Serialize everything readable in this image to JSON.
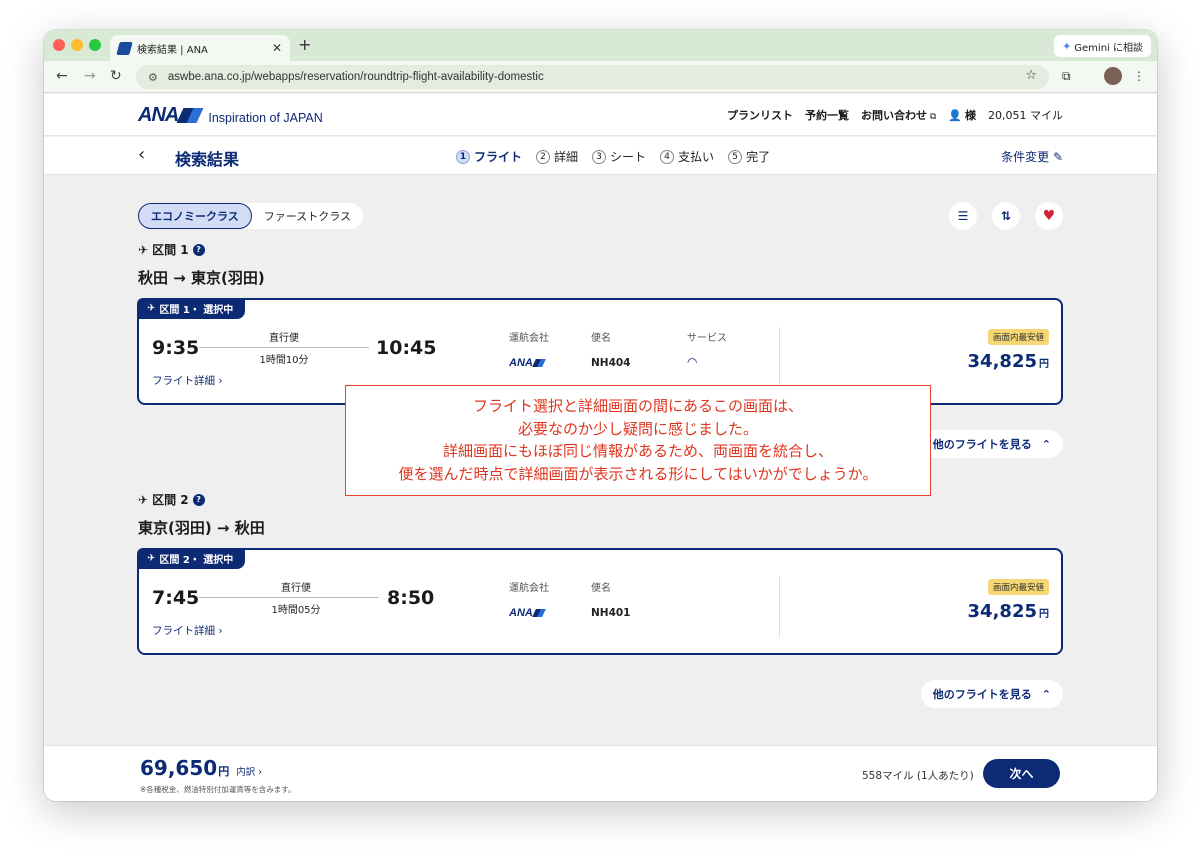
{
  "browser": {
    "tab_title": "検索結果 | ANA",
    "tab_close": "✕",
    "new_tab": "+",
    "url": "aswbe.ana.co.jp/webapps/reservation/roundtrip-flight-availability-domestic",
    "gemini_label": "Gemini に相談"
  },
  "site": {
    "logo_text": "ANA",
    "tagline": "Inspiration of JAPAN",
    "links": [
      "プランリスト",
      "予約一覧",
      "お問い合わせ"
    ],
    "user_label": "様",
    "miles": "20,051 マイル"
  },
  "stepbar": {
    "title": "検索結果",
    "steps": [
      {
        "num": "1",
        "label": "フライト"
      },
      {
        "num": "2",
        "label": "詳細"
      },
      {
        "num": "3",
        "label": "シート"
      },
      {
        "num": "4",
        "label": "支払い"
      },
      {
        "num": "5",
        "label": "完了"
      }
    ],
    "active_step": 1,
    "change_label": "条件変更"
  },
  "class_toggle": {
    "options": [
      "エコノミークラス",
      "ファーストクラス"
    ],
    "selected": "エコノミークラス"
  },
  "segments": [
    {
      "label": "区間 1",
      "route": "秋田 → 東京(羽田)",
      "badge": "区間 1・ 選択中",
      "dep": "9:35",
      "arr": "10:45",
      "direct": "直行便",
      "duration": "1時間10分",
      "detail_link": "フライト詳細",
      "col_airline": "運航会社",
      "col_flight": "便名",
      "col_service": "サービス",
      "airline": "ANA",
      "flight_no": "NH404",
      "lowest_badge": "画面内最安値",
      "price": "34,825",
      "yen": "円",
      "more": "他のフライトを見る"
    },
    {
      "label": "区間 2",
      "route": "東京(羽田) → 秋田",
      "badge": "区間 2・ 選択中",
      "dep": "7:45",
      "arr": "8:50",
      "direct": "直行便",
      "duration": "1時間05分",
      "detail_link": "フライト詳細",
      "col_airline": "運航会社",
      "col_flight": "便名",
      "airline": "ANA",
      "flight_no": "NH401",
      "lowest_badge": "画面内最安値",
      "price": "34,825",
      "yen": "円",
      "more": "他のフライトを見る"
    }
  ],
  "annotation": {
    "lines": [
      "フライト選択と詳細画面の間にあるこの画面は、",
      "必要なのか少し疑問に感じました。",
      "詳細画面にもほぼ同じ情報があるため、両画面を統合し、",
      "便を選んだ時点で詳細画面が表示される形にしてはいかがでしょうか。"
    ],
    "color": "#e0351f"
  },
  "footer": {
    "total": "69,650",
    "yen": "円",
    "breakdown": "内訳",
    "tax_note": "※各種税金、燃油特別付加運賃等を含みます。",
    "miles_note": "558マイル (1人あたり)",
    "next": "次へ"
  },
  "colors": {
    "brand": "#0d2a75",
    "highlight": "#f6d774",
    "favorite": "#d0243a"
  }
}
